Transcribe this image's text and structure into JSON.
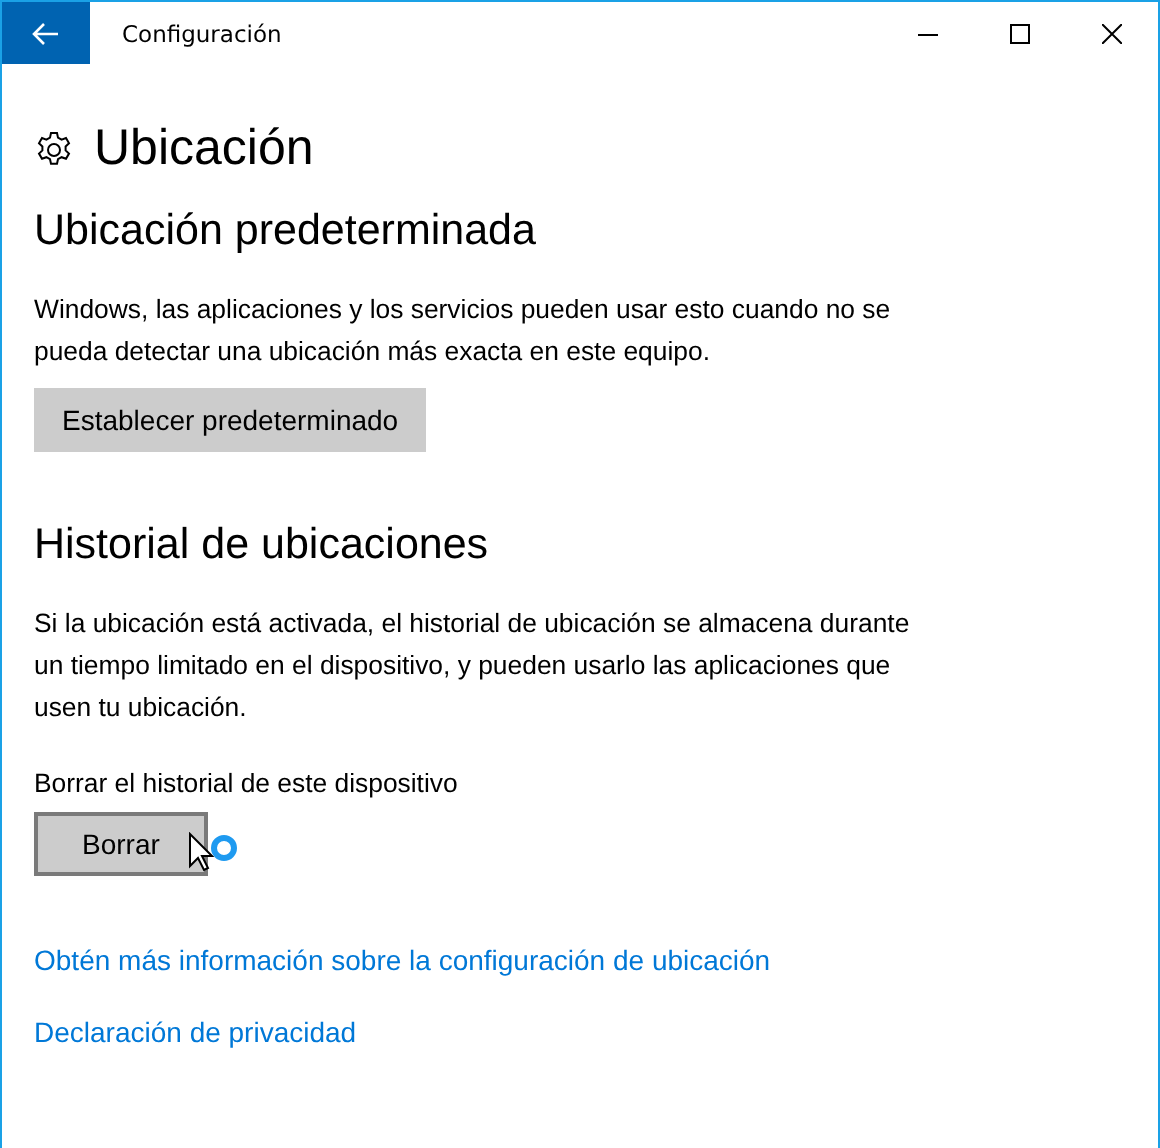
{
  "window": {
    "title": "Configuración"
  },
  "page_title": "Ubicación",
  "sections": [
    {
      "heading": "Ubicación predeterminada",
      "text": "Windows, las aplicaciones y los servicios pueden usar esto cuando no se pueda detectar una ubicación más exacta en este equipo.",
      "button": {
        "label": "Establecer predeterminado",
        "hovered": false
      }
    },
    {
      "heading": "Historial de ubicaciones",
      "text": "Si la ubicación está activada, el historial de ubicación se almacena durante un tiempo limitado en el dispositivo, y pueden usarlo las aplicaciones que usen tu ubicación.",
      "label": "Borrar el historial de este dispositivo",
      "button": {
        "label": "Borrar",
        "hovered": true
      }
    }
  ],
  "links": [
    "Obtén más información sobre la configuración de ubicación",
    "Declaración de privacidad"
  ]
}
